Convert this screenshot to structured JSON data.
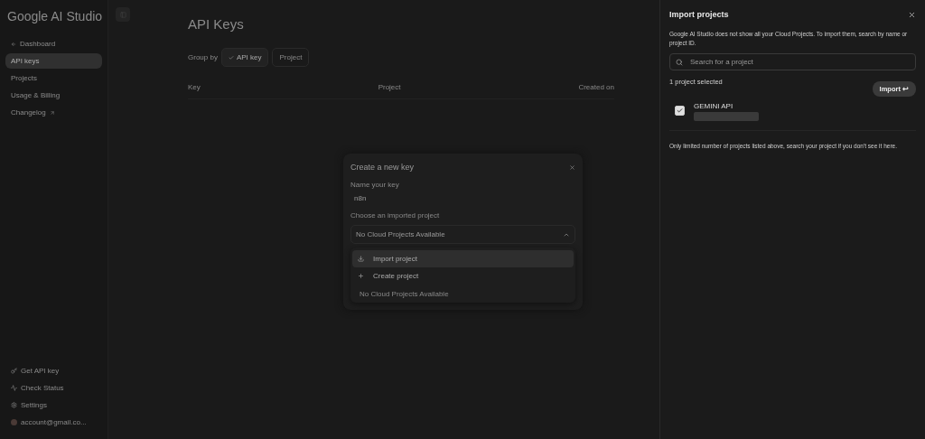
{
  "sidebar": {
    "logo": "Google AI Studio",
    "items": [
      {
        "label": "Dashboard",
        "kind": "back",
        "selected": false
      },
      {
        "label": "API keys",
        "kind": "plain",
        "selected": true
      },
      {
        "label": "Projects",
        "kind": "plain",
        "selected": false
      },
      {
        "label": "Usage & Billing",
        "kind": "plain",
        "selected": false
      },
      {
        "label": "Changelog",
        "kind": "external",
        "selected": false
      }
    ],
    "footer": [
      {
        "label": "Get API key",
        "kind": "key"
      },
      {
        "label": "Check Status",
        "kind": "status"
      },
      {
        "label": "Settings",
        "kind": "settings"
      },
      {
        "label": "account@gmail.co...",
        "kind": "avatar"
      }
    ]
  },
  "main": {
    "title": "API Keys",
    "group_by": {
      "label": "Group by",
      "options": [
        {
          "label": "API key",
          "selected": true
        },
        {
          "label": "Project",
          "selected": false
        }
      ]
    },
    "columns": [
      "Key",
      "Project",
      "Created on"
    ]
  },
  "dialog": {
    "title": "Create a new key",
    "name_label": "Name your key",
    "name_value": "n8n",
    "project_label": "Choose an imported project",
    "project_value": "No Cloud Projects Available",
    "menu": [
      {
        "label": "Import project",
        "kind": "import",
        "selected": true
      },
      {
        "label": "Create project",
        "kind": "create",
        "selected": false
      }
    ],
    "menu_note": "No Cloud Projects Available"
  },
  "panel": {
    "title": "Import projects",
    "intro": "Google AI Studio does not show all your Cloud Projects. To import them, search by name or project ID.",
    "search": {
      "placeholder": "Search for a project"
    },
    "selected_count": "1 project selected",
    "import_button": "Import ↩",
    "projects": [
      {
        "name": "GEMINI API",
        "checked": true
      }
    ],
    "note": "Only limited number of projects listed above, search your project if you don't see it here."
  }
}
